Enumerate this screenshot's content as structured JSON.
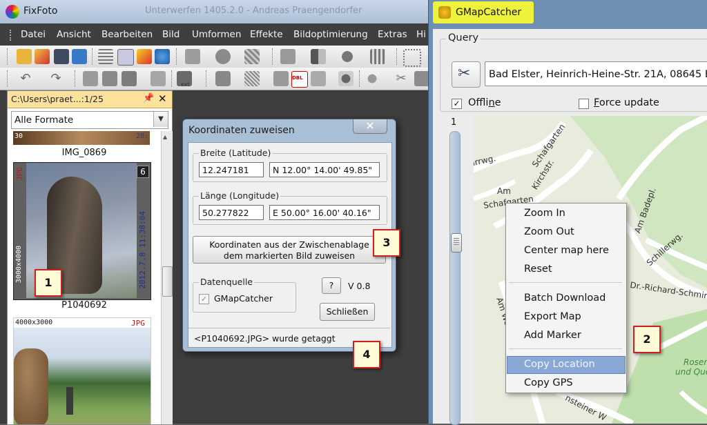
{
  "fixfoto": {
    "title": "FixFoto",
    "title_extra": "Unterwerfen 1405.2.0 - Andreas Praengendorfer",
    "menu": [
      "Datei",
      "Ansicht",
      "Bearbeiten",
      "Bild",
      "Umformen",
      "Effekte",
      "Bildoptimierung",
      "Extras",
      "Hi"
    ],
    "panel": {
      "path": "C:\\Users\\praet...:1/25",
      "pin_icon": "pin-icon",
      "close_icon": "close-icon",
      "format_value": "Alle Formate",
      "thumbs": [
        {
          "caption": "IMG_0869",
          "left_label": "30",
          "right_label": "20:"
        },
        {
          "caption": "P1040692",
          "format": "JPG",
          "badge": "6",
          "date": "2012.7.8 11:38:04",
          "size": "3000x4000"
        },
        {
          "caption": "",
          "format": "JPG",
          "size": "4000x3000"
        }
      ],
      "ext_label": "ext",
      "dbl_label": "DBL"
    }
  },
  "dialog": {
    "title": "Koordinaten zuweisen",
    "close": "✕",
    "lat_group": "Breite (Latitude)",
    "lat_decimal": "12.247181",
    "lat_dms": "N 12.00° 14.00' 49.85\"",
    "lon_group": "Länge (Longitude)",
    "lon_decimal": "50.277822",
    "lon_dms": "E 50.00° 16.00' 40.16\"",
    "assign_line1": "Koordinaten aus der Zwischenablage",
    "assign_line2": "dem markierten Bild zuweisen",
    "source_group": "Datenquelle",
    "source_item": "GMapCatcher",
    "help": "?",
    "version": "V 0.8",
    "close_button": "Schließen",
    "status": "<P1040692.JPG> wurde getaggt"
  },
  "gmapcatcher": {
    "title": "GMapCatcher",
    "query_label": "Query",
    "query_value": "Bad Elster, Heinrich-Heine-Str. 21A, 08645 Ba",
    "offline": {
      "label_pre": "Offli",
      "label_ul": "n",
      "label_post": "e",
      "checked": true
    },
    "force_update": {
      "label_pre": "",
      "label_ul": "F",
      "label_post": "orce update",
      "checked": false
    },
    "zoom_level": "1",
    "streets": [
      "Schafgarten",
      "Kirchstr.",
      "Am",
      "Schafgarten",
      "Am Badepl.",
      "Schillerwg.",
      "Dr.-Richard-Schmin",
      "Am Wolfsberg",
      "Rosen",
      "und Que",
      "arrwg.",
      "nsteiner W"
    ],
    "context_menu": [
      "Zoom In",
      "Zoom Out",
      "Center map here",
      "Reset",
      "Batch Download",
      "Export Map",
      "Add Marker",
      "Copy Location",
      "Copy GPS"
    ]
  },
  "callouts": [
    "1",
    "2",
    "3",
    "4"
  ],
  "colors": {
    "accent": "#cf1f1f",
    "callout_bg": "#fffbd6",
    "title_highlight": "#eef23a",
    "panel_header": "#fde29e"
  }
}
